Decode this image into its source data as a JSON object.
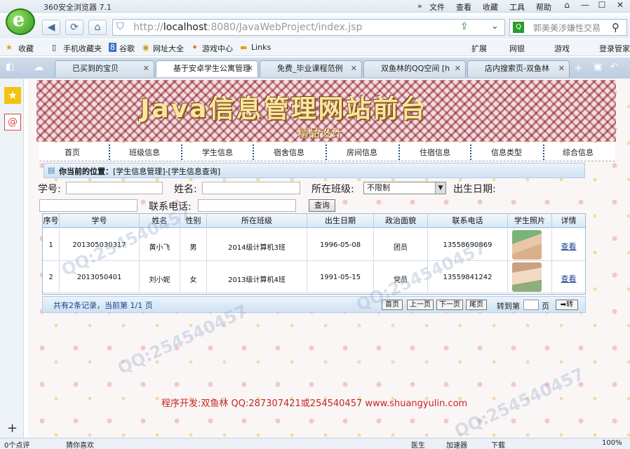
{
  "browser": {
    "title": "360安全浏览器 7.1",
    "menu": [
      "文件",
      "查看",
      "收藏",
      "工具",
      "帮助"
    ],
    "address": {
      "host": "localhost",
      "prefix": "http://",
      "rest": ":8080/JavaWebProject/index.jsp"
    },
    "search_placeholder": "郭美美涉嫌性交易",
    "favorites": [
      "收藏",
      "手机收藏夹",
      "谷歌",
      "网址大全",
      "游戏中心",
      "Links"
    ],
    "right_tools": [
      "扩展",
      "网银",
      "游戏",
      "登录管家"
    ],
    "tabs": [
      "已买到的宝贝",
      "基于安卓学生公寓管理",
      "免费_毕业课程范例",
      "双鱼林的QQ空间 [h",
      "店内搜索页-双鱼林"
    ],
    "status": {
      "left": "0个点评",
      "hint": "猜你喜欢",
      "items": [
        "医生",
        "加速器",
        "下载",
        "100%"
      ]
    }
  },
  "site": {
    "banner_title": "Java信息管理网站前台",
    "banner_sub": "精品设计",
    "nav": [
      "首页",
      "班级信息",
      "学生信息",
      "宿舍信息",
      "房间信息",
      "住宿信息",
      "信息类型",
      "综合信息"
    ],
    "location_label": "你当前的位置：",
    "location_path": "[学生信息管理]-[学生信息查询]",
    "form": {
      "student_no_label": "学号:",
      "name_label": "姓名:",
      "class_label": "所在班级:",
      "class_value": "不限制",
      "birth_label": "出生日期:",
      "phone_label": "联系电话:",
      "query_button": "查询"
    },
    "table": {
      "headers": [
        "序号",
        "学号",
        "姓名",
        "性别",
        "所在班级",
        "出生日期",
        "政治面貌",
        "联系电话",
        "学生照片",
        "详情"
      ],
      "rows": [
        {
          "no": "1",
          "id": "201305030317",
          "name": "黄小飞",
          "sex": "男",
          "class": "2014级计算机3班",
          "birth": "1996-05-08",
          "politics": "团员",
          "phone": "13558690869",
          "detail": "查看"
        },
        {
          "no": "2",
          "id": "2013050401",
          "name": "刘小妮",
          "sex": "女",
          "class": "2013级计算机4班",
          "birth": "1991-05-15",
          "politics": "党员",
          "phone": "13559841242",
          "detail": "查看"
        }
      ]
    },
    "pager": {
      "summary": "共有2条记录，当前第 1/1 页",
      "first": "首页",
      "prev": "上一页",
      "next": "下一页",
      "last": "尾页",
      "goto_label": "转到第",
      "page_unit": "页",
      "go": "➡转"
    },
    "footer": "程序开发:双鱼林 QQ:287307421或254540457 www.shuangyulin.com",
    "watermark": "QQ:254540457"
  }
}
